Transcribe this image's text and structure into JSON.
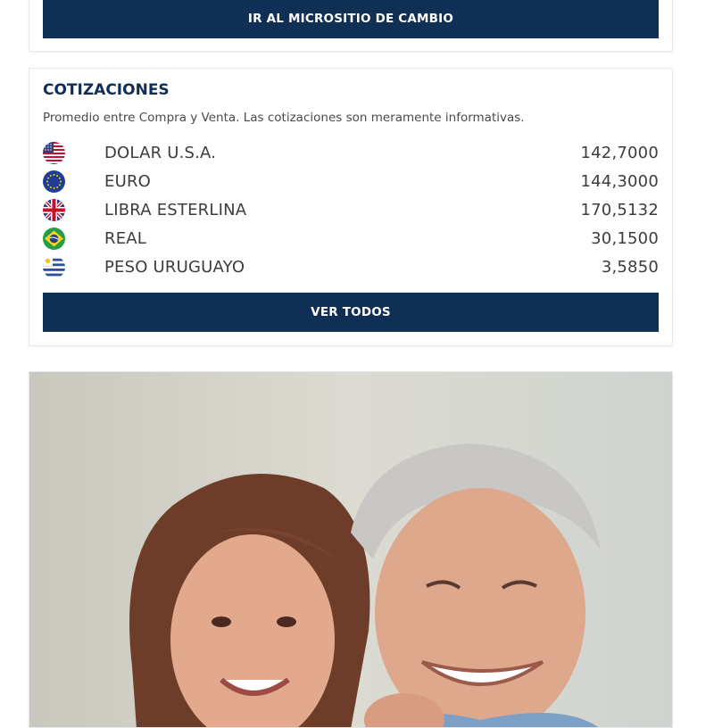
{
  "top_card": {
    "button_label": "IR AL MICROSITIO DE CAMBIO"
  },
  "cotizaciones": {
    "title": "COTIZACIONES",
    "subtitle": "Promedio entre Compra y Venta. Las cotizaciones son meramente informativas.",
    "rates": [
      {
        "flag": "usa-flag-icon",
        "name": "DOLAR U.S.A.",
        "value": "142,7000"
      },
      {
        "flag": "eu-flag-icon",
        "name": "EURO",
        "value": "144,3000"
      },
      {
        "flag": "uk-flag-icon",
        "name": "LIBRA ESTERLINA",
        "value": "170,5132"
      },
      {
        "flag": "brazil-flag-icon",
        "name": "REAL",
        "value": "30,1500"
      },
      {
        "flag": "uruguay-flag-icon",
        "name": "PESO URUGUAYO",
        "value": "3,5850"
      }
    ],
    "button_label": "VER TODOS"
  },
  "colors": {
    "navy": "#102f55",
    "text": "#3c3c3c"
  }
}
